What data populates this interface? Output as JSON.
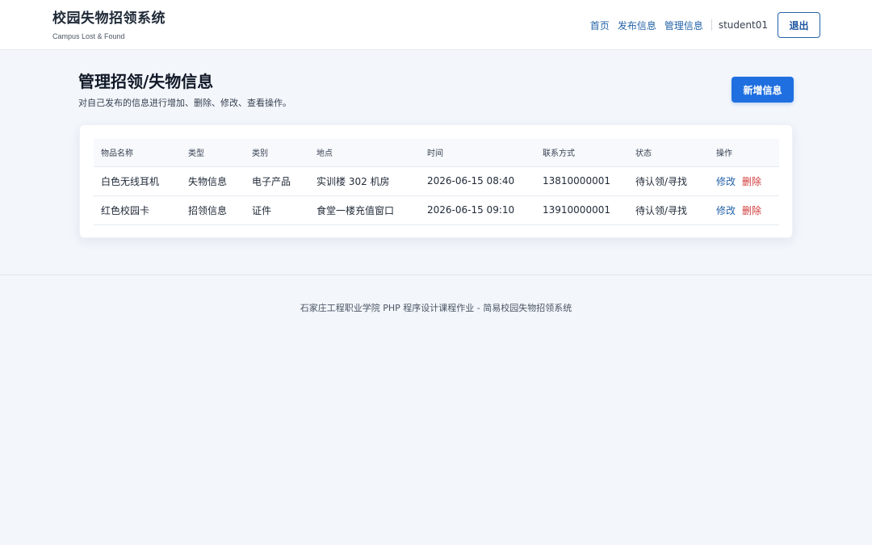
{
  "brand": {
    "title": "校园失物招领系统",
    "subtitle": "Campus Lost & Found"
  },
  "nav": {
    "links": [
      "首页",
      "发布信息",
      "管理信息"
    ],
    "user": "student01",
    "logout_label": "退出"
  },
  "page": {
    "title": "管理招领/失物信息",
    "description": "对自己发布的信息进行增加、删除、修改、查看操作。",
    "add_label": "新增信息"
  },
  "table": {
    "headers": [
      "物品名称",
      "类型",
      "类别",
      "地点",
      "时间",
      "联系方式",
      "状态",
      "操作"
    ],
    "rows": [
      {
        "name": "白色无线耳机",
        "type": "失物信息",
        "category": "电子产品",
        "location": "实训楼 302 机房",
        "time": "2026-06-15 08:40",
        "contact": "13810000001",
        "status": "待认领/寻找",
        "edit": "修改",
        "delete": "删除"
      },
      {
        "name": "红色校园卡",
        "type": "招领信息",
        "category": "证件",
        "location": "食堂一楼充值窗口",
        "time": "2026-06-15 09:10",
        "contact": "13910000001",
        "status": "待认领/寻找",
        "edit": "修改",
        "delete": "删除"
      }
    ]
  },
  "footer": {
    "text": "石家庄工程职业学院 PHP 程序设计课程作业 - 简易校园失物招领系统"
  },
  "colors": {
    "primary": "#1f6fe0",
    "link": "#2563a8",
    "danger": "#d33a3a",
    "background": "#f3f6fb"
  }
}
